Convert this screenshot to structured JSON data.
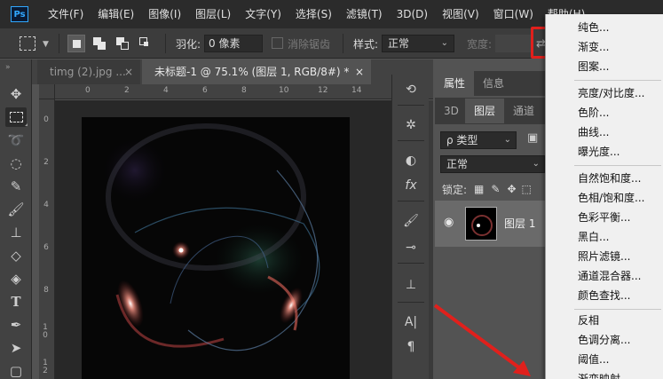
{
  "menubar": {
    "logo": "Ps",
    "items": [
      "文件(F)",
      "编辑(E)",
      "图像(I)",
      "图层(L)",
      "文字(Y)",
      "选择(S)",
      "滤镜(T)",
      "3D(D)",
      "视图(V)",
      "窗口(W)",
      "帮助(H)"
    ]
  },
  "options": {
    "feather_label": "羽化:",
    "feather_value": "0 像素",
    "antialias_label": "消除锯齿",
    "style_label": "样式:",
    "style_value": "正常",
    "width_label": "宽度:"
  },
  "tabs": [
    {
      "label": "timg (2).jpg ...",
      "close": "×"
    },
    {
      "label": "未标题-1 @ 75.1% (图层 1, RGB/8#) *",
      "close": "×"
    }
  ],
  "ruler": {
    "top": [
      "0",
      "2",
      "4",
      "6",
      "8",
      "10",
      "12",
      "14"
    ],
    "left": [
      "0",
      "2",
      "4",
      "6",
      "8",
      "1 0",
      "1 2"
    ]
  },
  "panels": {
    "top_tabs": [
      "属性",
      "信息"
    ],
    "layer_tabs": [
      "3D",
      "图层",
      "通道"
    ],
    "kind_label": "ρ 类型",
    "blend_mode": "正常",
    "lock_label": "锁定:",
    "layer_name": "图层 1"
  },
  "dropdown": {
    "group1": [
      "纯色...",
      "渐变...",
      "图案..."
    ],
    "group2": [
      "亮度/对比度...",
      "色阶...",
      "曲线...",
      "曝光度..."
    ],
    "group3": [
      "自然饱和度...",
      "色相/饱和度...",
      "色彩平衡...",
      "黑白...",
      "照片滤镜...",
      "通道混合器...",
      "颜色查找..."
    ],
    "group4": [
      "反相",
      "色调分离...",
      "阈值...",
      "渐变映射..."
    ]
  },
  "colors": {
    "highlight": "#e0201c",
    "arrow": "#e0201c",
    "ps_blue": "#31a8ff"
  }
}
